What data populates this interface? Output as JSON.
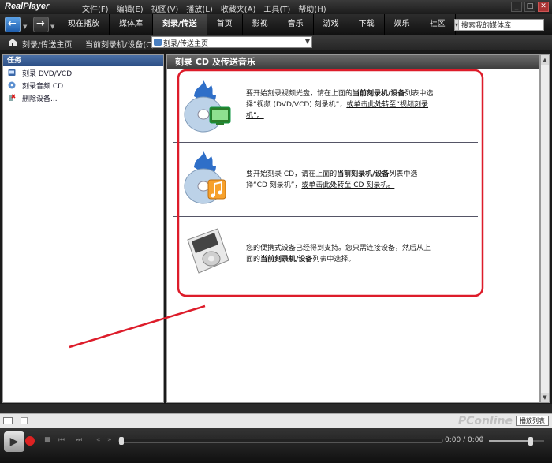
{
  "app": {
    "logo": "RealPlayer",
    "menu": [
      "文件(F)",
      "编辑(E)",
      "视图(V)",
      "播放(L)",
      "收藏夹(A)",
      "工具(T)",
      "帮助(H)"
    ]
  },
  "tabs": [
    {
      "label": "现在播放",
      "active": false
    },
    {
      "label": "媒体库",
      "active": false
    },
    {
      "label": "刻录/传送",
      "active": true
    },
    {
      "label": "首页",
      "active": false
    },
    {
      "label": "影视",
      "active": false
    },
    {
      "label": "音乐",
      "active": false
    },
    {
      "label": "游戏",
      "active": false
    },
    {
      "label": "下载",
      "active": false
    },
    {
      "label": "娱乐",
      "active": false
    },
    {
      "label": "社区",
      "active": false
    }
  ],
  "search": {
    "value": "搜索我的媒体库"
  },
  "breadcrumb": {
    "home": "刻录/传送主页",
    "device": "当前刻录机/设备(C)",
    "address": "刻录/传送主页"
  },
  "sidebar": {
    "header": "任务",
    "items": [
      {
        "label": "刻录 DVD/VCD",
        "icon": "dvd-icon"
      },
      {
        "label": "刻录音频 CD",
        "icon": "cd-audio-icon"
      },
      {
        "label": "删除设备...",
        "icon": "delete-device-icon"
      }
    ]
  },
  "main": {
    "title": "刻录 CD 及传送音乐",
    "sections": [
      {
        "icon": "video-burn-icon",
        "p1": "要开始刻录视频光盘，请在上面的",
        "b1": "当前刻录机/设备",
        "p2": "列表中选择“视频 (DVD/VCD) 刻录机”，",
        "link": "或单击此处转至“视频刻录机”。"
      },
      {
        "icon": "cd-burn-icon",
        "p1": "要开始刻录 CD，请在上面的",
        "b1": "当前刻录机/设备",
        "p2": "列表中选择“CD 刻录机”，",
        "link": "或单击此处转至 CD 刻录机。"
      },
      {
        "icon": "portable-device-icon",
        "p1": "您的便携式设备已经得到支持。您只需连接设备，然后从上面的",
        "b1": "当前刻录机/设备",
        "p2": "列表中选择。",
        "link": ""
      }
    ]
  },
  "infobar": {
    "watermark": "PConline",
    "playlist": "播放列表"
  },
  "player": {
    "time": "0:00 / 0:00",
    "progress": 0,
    "volume": 0.75
  },
  "colors": {
    "annotation": "#dd1c2a",
    "accent": "#2c4f86"
  }
}
